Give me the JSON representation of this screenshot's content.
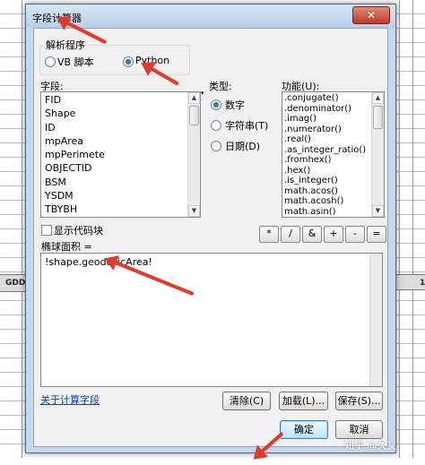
{
  "background_table": {
    "col_header_left": "GDD",
    "col_header_right": "1"
  },
  "dialog": {
    "title": "字段计算器",
    "close_glyph": "✕",
    "parser": {
      "legend": "解析程序",
      "options": [
        "VB 脚本",
        "Python"
      ],
      "selected": "Python"
    },
    "fields": {
      "label": "字段:",
      "items": [
        "FID",
        "Shape",
        "ID",
        "mpArea",
        "mpPerimete",
        "OBJECTID",
        "BSM",
        "YSDM",
        "TBYBH"
      ]
    },
    "type": {
      "label": "类型:",
      "options": [
        "数字",
        "字符串(T)",
        "日期(D)"
      ],
      "selected": "数字"
    },
    "functions": {
      "label": "功能(U):",
      "items": [
        ".conjugate()",
        ".denominator()",
        ".imag()",
        ".numerator()",
        ".real()",
        ".as_integer_ratio()",
        ".fromhex()",
        ".hex()",
        ".is_integer()",
        "math.acos()",
        "math.acosh()",
        "math.asin()"
      ]
    },
    "show_codeblock_label": "显示代码块",
    "expression_label": "椭球面积 =",
    "expression_value": "!shape.geodesicArea!",
    "operators": [
      "*",
      "/",
      "&",
      "+",
      "-",
      "="
    ],
    "about_link": "关于计算字段",
    "buttons": {
      "clear": "清除(C)",
      "load": "加载(L)...",
      "save": "保存(S)...",
      "ok": "确定",
      "cancel": "取消"
    }
  },
  "watermark": "知乎 @久又",
  "colors": {
    "annotation_arrow": "#e23a2e",
    "dialog_frame": "#c8d9ec",
    "link": "#0645ad"
  }
}
